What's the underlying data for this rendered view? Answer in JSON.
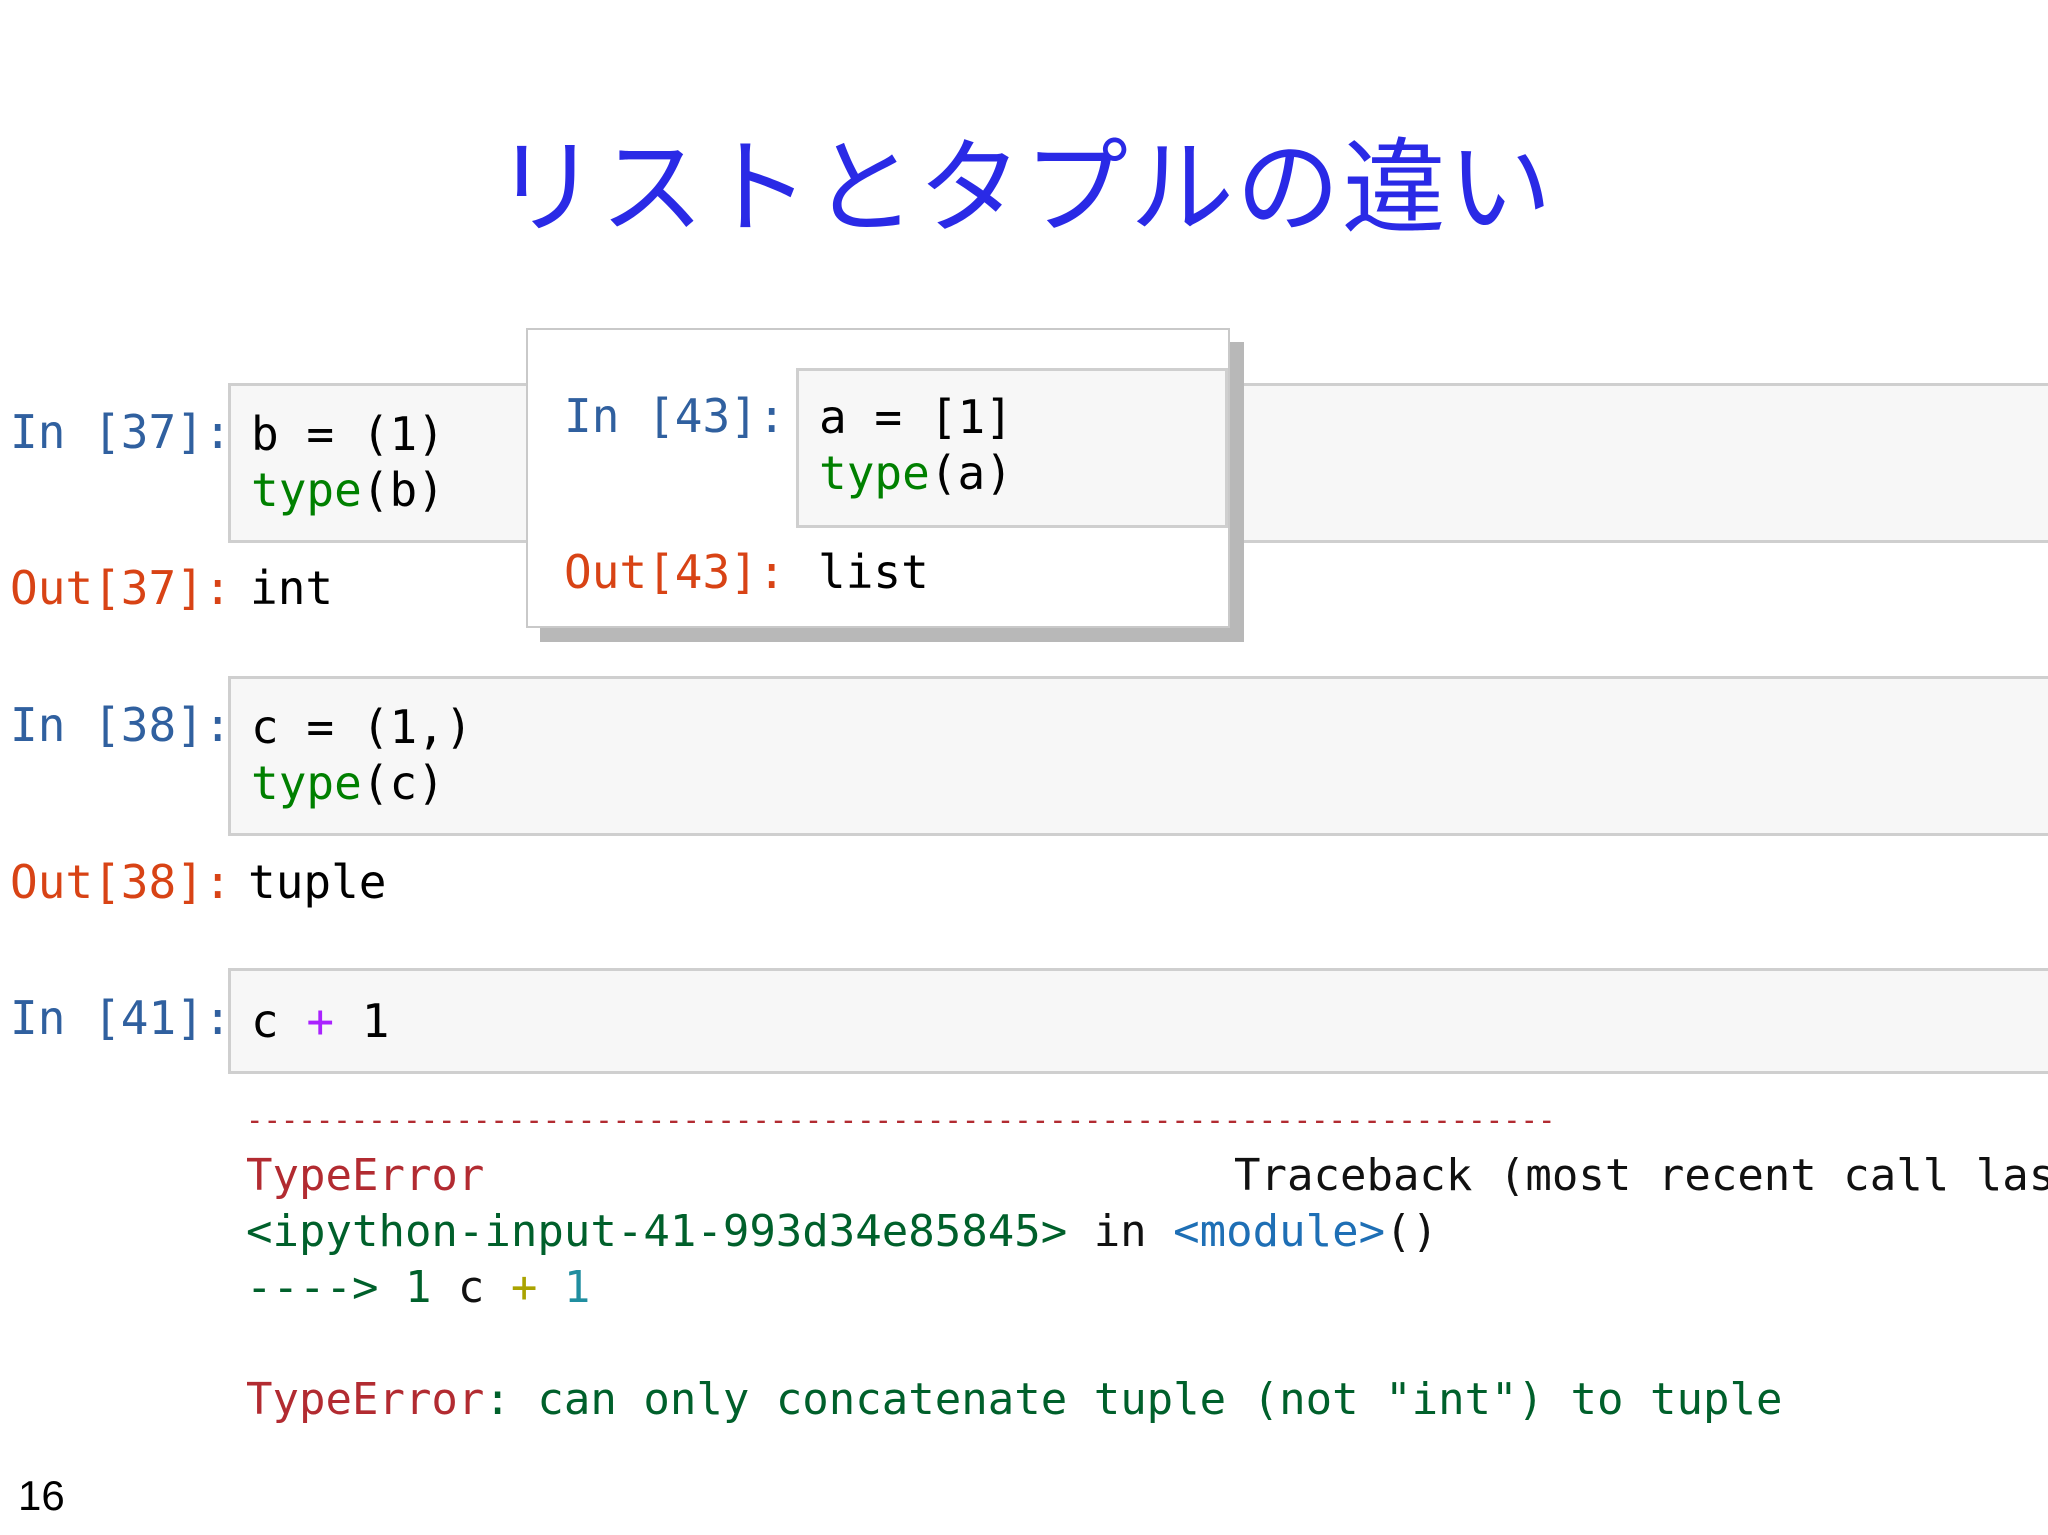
{
  "slide": {
    "title": "リストとタプルの違い",
    "page_number": "16"
  },
  "cells": {
    "c37": {
      "in_prompt": "In [37]:",
      "code_line1": "b = (1)",
      "code_line2_kw": "type",
      "code_line2_rest": "(b)",
      "out_prompt": "Out[37]:",
      "output": "int"
    },
    "c38": {
      "in_prompt": "In [38]:",
      "code_line1": "c = (1,)",
      "code_line2_kw": "type",
      "code_line2_rest": "(c)",
      "out_prompt": "Out[38]:",
      "output": "tuple"
    },
    "c41": {
      "in_prompt": "In [41]:",
      "code_a": "c ",
      "code_op": "+",
      "code_b": " 1",
      "traceback": {
        "dashes": "---------------------------------------------------------------------------",
        "error_name": "TypeError",
        "header_right": "Traceback (most recent call last)",
        "input_ref": "<ipython-input-41-993d34e85845>",
        "in_word": " in ",
        "module": "<module>",
        "module_parens": "()",
        "arrow": "---->",
        "arrow_lineno": " 1",
        "arrow_code_a": " c ",
        "arrow_op": "+",
        "arrow_code_b": " 1",
        "final_name": "TypeError",
        "final_msg": ": can only concatenate tuple (not \"int\") to tuple"
      }
    },
    "c43": {
      "in_prompt": "In [43]:",
      "code_line1": "a = [1]",
      "code_line2_kw": "type",
      "code_line2_rest": "(a)",
      "out_prompt": "Out[43]:",
      "output": "list"
    }
  }
}
